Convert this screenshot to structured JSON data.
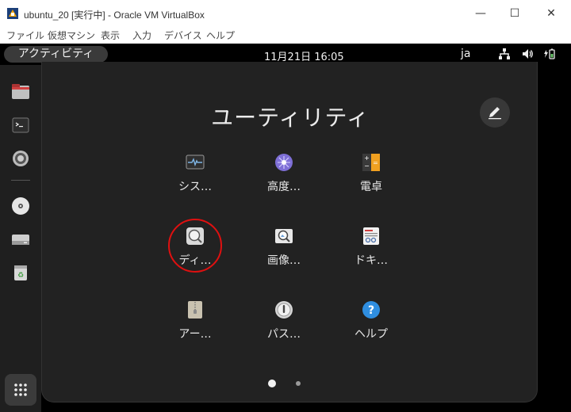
{
  "window": {
    "title": "ubuntu_20 [実行中] - Oracle VM VirtualBox",
    "minimize": "—",
    "maximize": "☐",
    "close": "✕"
  },
  "menu": [
    "ファイル",
    "仮想マシン",
    "表示",
    "入力",
    "デバイス",
    "ヘルプ"
  ],
  "topbar": {
    "activities": "アクティビティ",
    "clock": "11月21日  16:05",
    "lang": "ja"
  },
  "folder": {
    "title": "ユーティリティ",
    "apps": [
      {
        "label": "シス…",
        "icon": "system-monitor-icon"
      },
      {
        "label": "高度…",
        "icon": "advanced-settings-icon"
      },
      {
        "label": "電卓",
        "icon": "calculator-icon"
      },
      {
        "label": "ディ…",
        "icon": "disk-usage-icon"
      },
      {
        "label": "画像…",
        "icon": "image-viewer-icon"
      },
      {
        "label": "ドキ…",
        "icon": "document-viewer-icon"
      },
      {
        "label": "アー…",
        "icon": "archive-manager-icon"
      },
      {
        "label": "パス…",
        "icon": "passwords-icon"
      },
      {
        "label": "ヘルプ",
        "icon": "help-icon"
      }
    ]
  },
  "pagination": {
    "current_page": 1,
    "total_pages": 2
  },
  "colors": {
    "highlight": "#e01010",
    "panel": "#222222",
    "dock": "#1f1f1f"
  }
}
